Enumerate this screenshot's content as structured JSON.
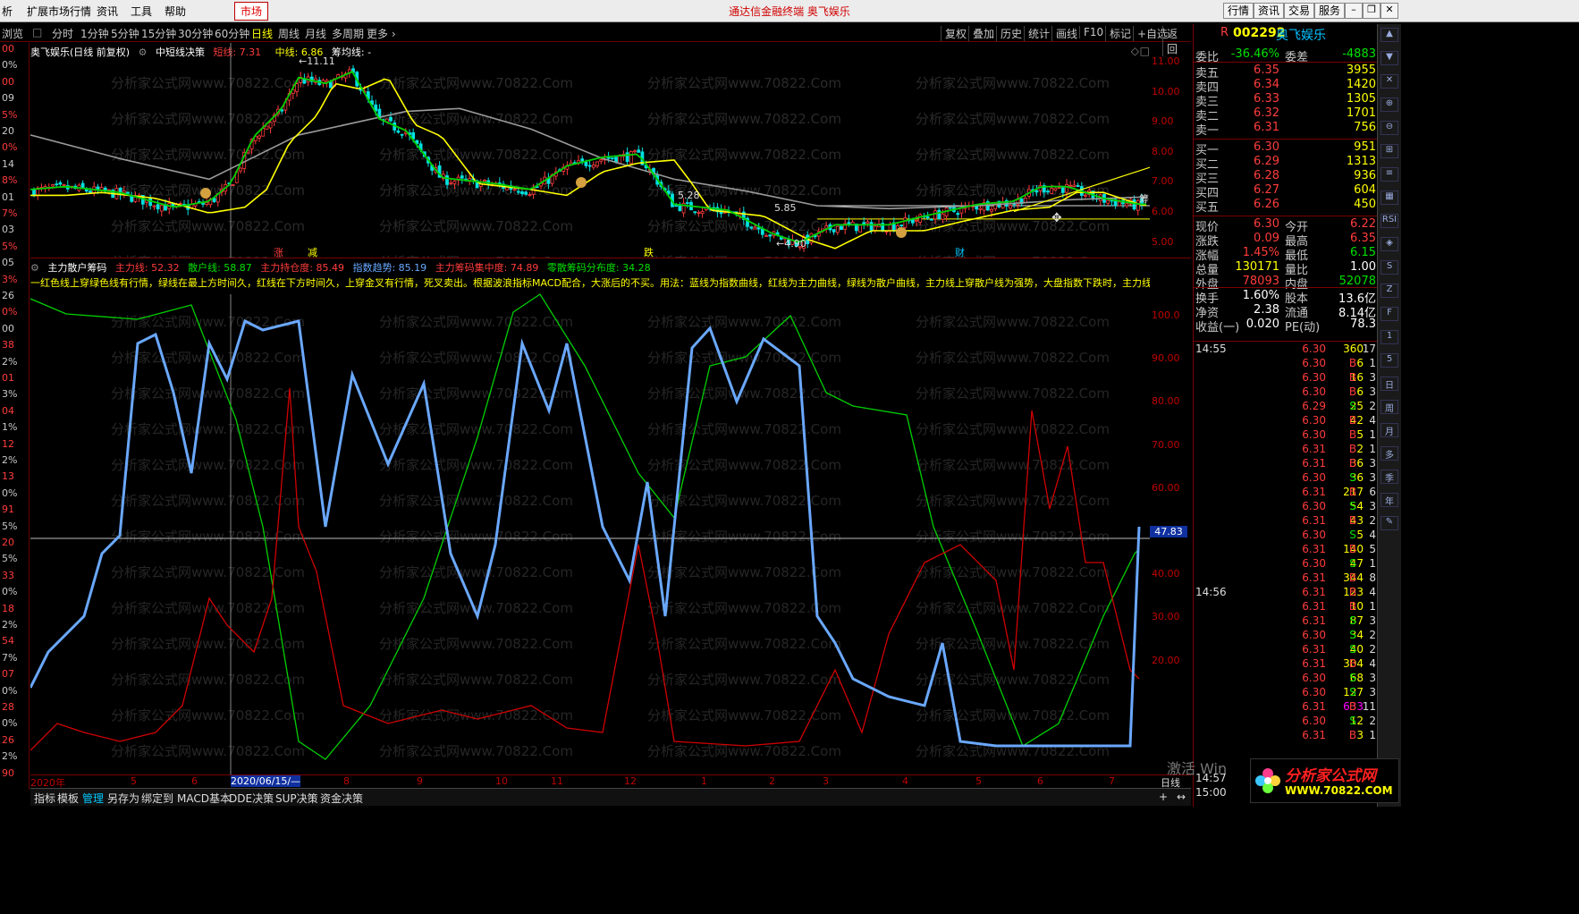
{
  "titlebar": {
    "menus": [
      "析",
      "扩展市场行情",
      "资讯",
      "工具",
      "帮助"
    ],
    "market_label": "市场",
    "center_title": "通达信金融终端  奥飞娱乐",
    "right_buttons": [
      "行情",
      "资讯",
      "交易",
      "服务"
    ],
    "win_buttons": [
      "–",
      "❐",
      "✕"
    ]
  },
  "periodbar": {
    "left_label": "浏览",
    "periods": [
      "分时",
      "1分钟",
      "5分钟",
      "15分钟",
      "30分钟",
      "60分钟",
      "日线",
      "周线",
      "月线",
      "多周期",
      "更多 ›"
    ],
    "active_period": "日线",
    "right_tools": [
      "复权",
      "叠加",
      "历史",
      "统计",
      "画线",
      "F10",
      "标记",
      "+自选",
      "返回"
    ]
  },
  "left_ruler": [
    "00",
    "0%",
    "00",
    "09",
    "5%",
    "20",
    "0%",
    "14",
    "8%",
    "01",
    "7%",
    "03",
    "5%",
    "05",
    "3%",
    "26",
    "0%",
    "00",
    "38",
    "2%",
    "01",
    "3%",
    "04",
    "1%",
    "12",
    "2%",
    "13",
    "0%",
    "91",
    "5%",
    "20",
    "5%",
    "33",
    "0%",
    "18",
    "2%",
    "54",
    "7%",
    "07",
    "0%",
    "28",
    "0%",
    "26",
    "2%",
    "90"
  ],
  "upper_pane": {
    "header": {
      "stock": "奥飞娱乐(日线 前复权)",
      "indicator": "中短线决策",
      "short_line": "短线: 7.31",
      "mid_line": "中线: 6.86",
      "chip_line": "筹均线: -"
    },
    "yaxis": [
      "11.00",
      "10.00",
      "9.00",
      "8.00",
      "7.00",
      "6.00",
      "5.00"
    ],
    "annotations": {
      "high": "11.11",
      "low": "4.90",
      "mark_a": "5.28",
      "mark_b": "5.85",
      "tag_zhang": "涨",
      "tag_jian": "减",
      "tag_die": "跌",
      "tag_cai": "财",
      "tag_chou": "筹"
    }
  },
  "lower_pane": {
    "header": {
      "name": "主力散户筹码",
      "main": "主力线: 52.32",
      "retail": "散户线: 58.87",
      "hold": "主力持仓度: 85.49",
      "index": "指数趋势: 85.19",
      "conc": "主力筹码集中度: 74.89",
      "dist": "零散筹码分布度: 34.28"
    },
    "note": "一红色线上穿绿色线有行情，绿线在最上方时间久，红线在下方时间久，上穿金叉有行情，死叉卖出。根据波浪指标MACD配合，大涨后的不买。用法：蓝线为指数曲线，红线为主力曲线，绿线为散户曲线，主力线上穿散户线为强势，大盘指数下跌时，主力线上穿指数",
    "yaxis": [
      "100.0",
      "90.00",
      "80.00",
      "70.00",
      "60.00",
      "50.00",
      "40.00",
      "30.00",
      "20.00"
    ],
    "cursor_value": "47.83",
    "watermark": "分析家公式网www.70822.Com"
  },
  "date_axis": {
    "labels": [
      "2020年",
      "5",
      "6",
      "2020/06/15/—",
      "8",
      "9",
      "10",
      "11",
      "12",
      "1",
      "2",
      "3",
      "4",
      "5",
      "6",
      "7"
    ],
    "right_label": "日线"
  },
  "tabbar": [
    "指标",
    "模板",
    "管理",
    "另存为",
    "绑定到",
    "MACD基本",
    "DDE决策",
    "SUP决策",
    "资金决策"
  ],
  "active_tab": "管理",
  "quote": {
    "code": "002292",
    "name": "奥飞娱乐",
    "weibi_label": "委比",
    "weibi": "-36.46%",
    "weicha_label": "委差",
    "weicha": "-4883",
    "asks": [
      {
        "label": "卖五",
        "price": "6.35",
        "vol": "3955"
      },
      {
        "label": "卖四",
        "price": "6.34",
        "vol": "1420"
      },
      {
        "label": "卖三",
        "price": "6.33",
        "vol": "1305"
      },
      {
        "label": "卖二",
        "price": "6.32",
        "vol": "1701"
      },
      {
        "label": "卖一",
        "price": "6.31",
        "vol": "756"
      }
    ],
    "bids": [
      {
        "label": "买一",
        "price": "6.30",
        "vol": "951"
      },
      {
        "label": "买二",
        "price": "6.29",
        "vol": "1313"
      },
      {
        "label": "买三",
        "price": "6.28",
        "vol": "936"
      },
      {
        "label": "买四",
        "price": "6.27",
        "vol": "604"
      },
      {
        "label": "买五",
        "price": "6.26",
        "vol": "450"
      }
    ],
    "stats": [
      {
        "l1": "现价",
        "v1": "6.30",
        "c1": "red",
        "l2": "今开",
        "v2": "6.22",
        "c2": "red"
      },
      {
        "l1": "涨跌",
        "v1": "0.09",
        "c1": "red",
        "l2": "最高",
        "v2": "6.35",
        "c2": "red"
      },
      {
        "l1": "涨幅",
        "v1": "1.45%",
        "c1": "red",
        "l2": "最低",
        "v2": "6.15",
        "c2": "grn"
      },
      {
        "l1": "总量",
        "v1": "130171",
        "c1": "yel",
        "l2": "量比",
        "v2": "1.00",
        "c2": "wht"
      },
      {
        "l1": "外盘",
        "v1": "78093",
        "c1": "red",
        "l2": "内盘",
        "v2": "52078",
        "c2": "grn"
      },
      {
        "l1": "换手",
        "v1": "1.60%",
        "c1": "wht",
        "l2": "股本",
        "v2": "13.6亿",
        "c2": "wht"
      },
      {
        "l1": "净资",
        "v1": "2.38",
        "c1": "wht",
        "l2": "流通",
        "v2": "8.14亿",
        "c2": "wht"
      },
      {
        "l1": "收益(一)",
        "v1": "0.020",
        "c1": "wht",
        "l2": "PE(动)",
        "v2": "78.3",
        "c2": "wht"
      }
    ],
    "ticks": [
      {
        "t": "14:55",
        "p": "6.30",
        "v": "360",
        "bs": "",
        "n": "17"
      },
      {
        "t": "",
        "p": "6.30",
        "v": "6",
        "bs": "B",
        "n": "1"
      },
      {
        "t": "",
        "p": "6.30",
        "v": "16",
        "bs": "B",
        "n": "3"
      },
      {
        "t": "",
        "p": "6.30",
        "v": "6",
        "bs": "B",
        "n": "3"
      },
      {
        "t": "",
        "p": "6.29",
        "v": "25",
        "bs": "S",
        "n": "2"
      },
      {
        "t": "",
        "p": "6.30",
        "v": "42",
        "bs": "B",
        "n": "4"
      },
      {
        "t": "",
        "p": "6.30",
        "v": "5",
        "bs": "B",
        "n": "1"
      },
      {
        "t": "",
        "p": "6.31",
        "v": "2",
        "bs": "B",
        "n": "1"
      },
      {
        "t": "",
        "p": "6.31",
        "v": "36",
        "bs": "B",
        "n": "3"
      },
      {
        "t": "",
        "p": "6.30",
        "v": "36",
        "bs": "S",
        "n": "3"
      },
      {
        "t": "",
        "p": "6.31",
        "v": "217",
        "bs": "B",
        "n": "6"
      },
      {
        "t": "",
        "p": "6.30",
        "v": "54",
        "bs": "S",
        "n": "3"
      },
      {
        "t": "",
        "p": "6.31",
        "v": "43",
        "bs": "B",
        "n": "2"
      },
      {
        "t": "",
        "p": "6.30",
        "v": "5",
        "bs": "S",
        "n": "4"
      },
      {
        "t": "",
        "p": "6.31",
        "v": "140",
        "bs": "B",
        "n": "5"
      },
      {
        "t": "",
        "p": "6.30",
        "v": "47",
        "bs": "S",
        "n": "1"
      },
      {
        "t": "",
        "p": "6.31",
        "v": "344",
        "bs": "B",
        "n": "8"
      },
      {
        "t": "14:56",
        "p": "6.31",
        "v": "123",
        "bs": "B",
        "n": "4"
      },
      {
        "t": "",
        "p": "6.31",
        "v": "10",
        "bs": "B",
        "n": "1"
      },
      {
        "t": "",
        "p": "6.31",
        "v": "87",
        "bs": "S",
        "n": "3"
      },
      {
        "t": "",
        "p": "6.30",
        "v": "34",
        "bs": "S",
        "n": "2"
      },
      {
        "t": "",
        "p": "6.31",
        "v": "40",
        "bs": "S",
        "n": "2"
      },
      {
        "t": "",
        "p": "6.31",
        "v": "304",
        "bs": "B",
        "n": "4"
      },
      {
        "t": "",
        "p": "6.30",
        "v": "68",
        "bs": "S",
        "n": "3"
      },
      {
        "t": "",
        "p": "6.30",
        "v": "127",
        "bs": "S",
        "n": "3"
      },
      {
        "t": "",
        "p": "6.31",
        "v": "633",
        "bs": "B",
        "n": "11"
      },
      {
        "t": "",
        "p": "6.30",
        "v": "12",
        "bs": "S",
        "n": "2"
      },
      {
        "t": "",
        "p": "6.31",
        "v": "3",
        "bs": "B",
        "n": "1"
      }
    ],
    "bottom_times": [
      "14:57",
      "15:00"
    ]
  },
  "icon_strip": [
    "▲",
    "▼",
    "✕",
    "⊕",
    "⊖",
    "⊞",
    "≡",
    "▦",
    "RSI",
    "◈",
    "S",
    "Z",
    "F",
    "1",
    "5",
    "日",
    "周",
    "月",
    "多",
    "季",
    "年",
    "✎"
  ],
  "watermark": {
    "activate": "激活 Win",
    "logo_text": "分析家公式网",
    "logo_url": "WWW.70822.COM"
  }
}
